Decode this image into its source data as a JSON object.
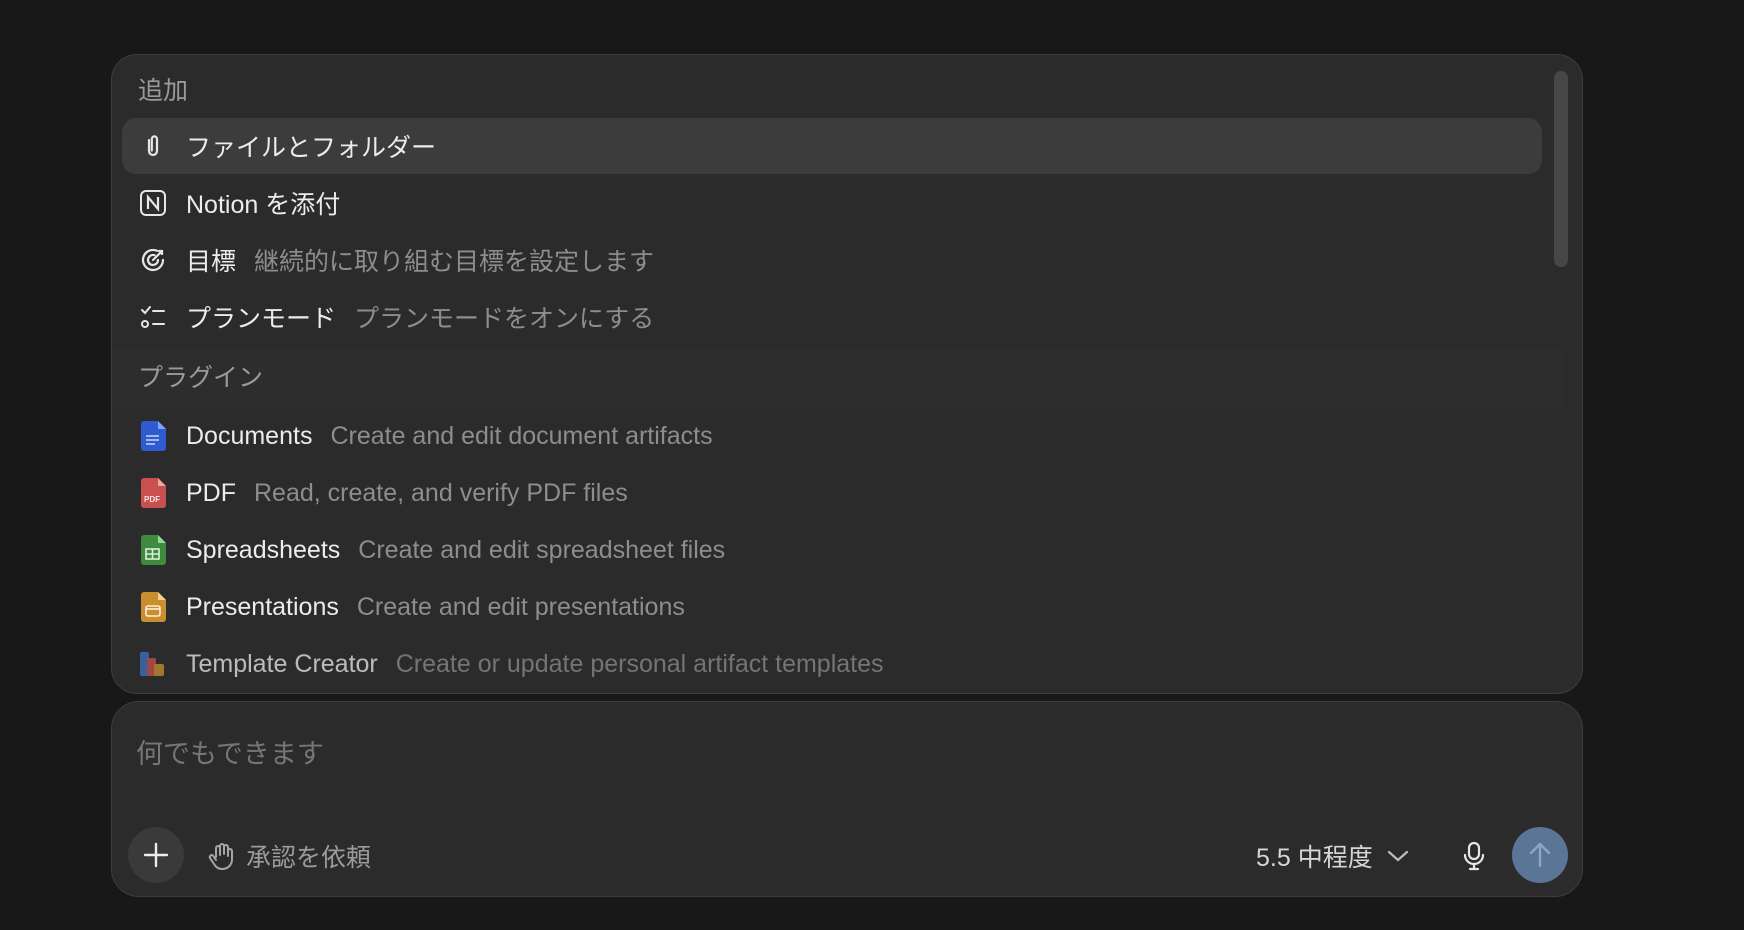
{
  "menu": {
    "section_add": "追加",
    "add_items": [
      {
        "title": "ファイルとフォルダー",
        "desc": "",
        "icon": "paperclip-icon"
      },
      {
        "title": "Notion を添付",
        "desc": "",
        "icon": "notion-icon"
      },
      {
        "title": "目標",
        "desc": "継続的に取り組む目標を設定します",
        "icon": "target-icon"
      },
      {
        "title": "プランモード",
        "desc": "プランモードをオンにする",
        "icon": "checklist-icon"
      }
    ],
    "section_plugins": "プラグイン",
    "plugin_items": [
      {
        "title": "Documents",
        "desc": "Create and edit document artifacts",
        "icon": "documents-icon"
      },
      {
        "title": "PDF",
        "desc": "Read, create, and verify PDF files",
        "icon": "pdf-icon",
        "badge": "PDF"
      },
      {
        "title": "Spreadsheets",
        "desc": "Create and edit spreadsheet files",
        "icon": "spreadsheet-icon"
      },
      {
        "title": "Presentations",
        "desc": "Create and edit presentations",
        "icon": "presentation-icon"
      },
      {
        "title": "Template Creator",
        "desc": "Create or update personal artifact templates",
        "icon": "template-icon"
      }
    ]
  },
  "composer": {
    "placeholder": "何でもできます",
    "approval_label": "承認を依頼",
    "model_label": "5.5 中程度"
  },
  "colors": {
    "background": "#181818",
    "panel": "#2b2b2b",
    "active_item": "#3c3c3c",
    "send_button": "#5a7595",
    "documents": "#2f5bd0",
    "pdf": "#c8504e",
    "spreadsheet": "#3f8a3f",
    "presentation": "#c98f2e"
  }
}
